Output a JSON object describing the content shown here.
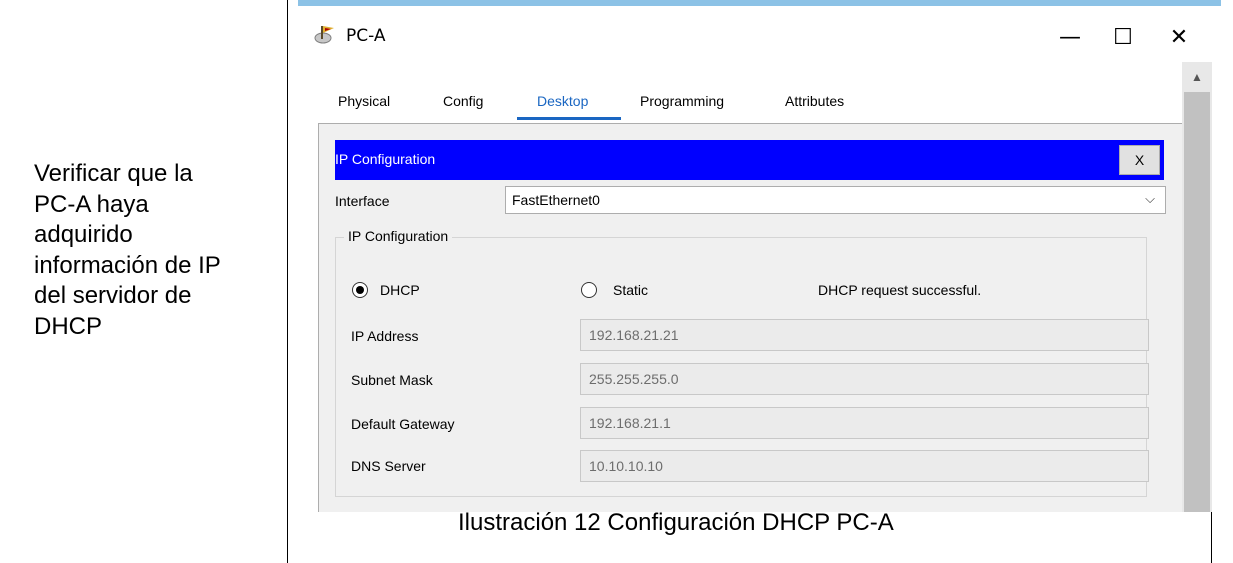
{
  "left_text": "Verificar que la\nPC-A haya\nadquirido\ninformación de IP\ndel servidor de\nDHCP",
  "caption": "Ilustración 12 Configuración DHCP PC-A",
  "window": {
    "title": "PC-A",
    "icon": "pc-app-icon",
    "minimize_symbol": "—",
    "maximize_symbol": "☐",
    "close_symbol": "✕"
  },
  "tabs": [
    {
      "label": "Physical",
      "active": false
    },
    {
      "label": "Config",
      "active": false
    },
    {
      "label": "Desktop",
      "active": true
    },
    {
      "label": "Programming",
      "active": false
    },
    {
      "label": "Attributes",
      "active": false
    }
  ],
  "ip_config": {
    "title": "IP Configuration",
    "close_label": "X",
    "interface_label": "Interface",
    "interface_value": "FastEthernet0",
    "group_title": "IP Configuration",
    "mode_dhcp": "DHCP",
    "mode_static": "Static",
    "selected_mode": "DHCP",
    "status": "DHCP request successful.",
    "fields": [
      {
        "label": "IP Address",
        "value": "192.168.21.21"
      },
      {
        "label": "Subnet Mask",
        "value": "255.255.255.0"
      },
      {
        "label": "Default Gateway",
        "value": "192.168.21.1"
      },
      {
        "label": "DNS Server",
        "value": "10.10.10.10"
      }
    ]
  },
  "colors": {
    "title_bar": "#0000ff",
    "active_tab": "#1a66c2",
    "panel_bg": "#f0f0f0"
  }
}
